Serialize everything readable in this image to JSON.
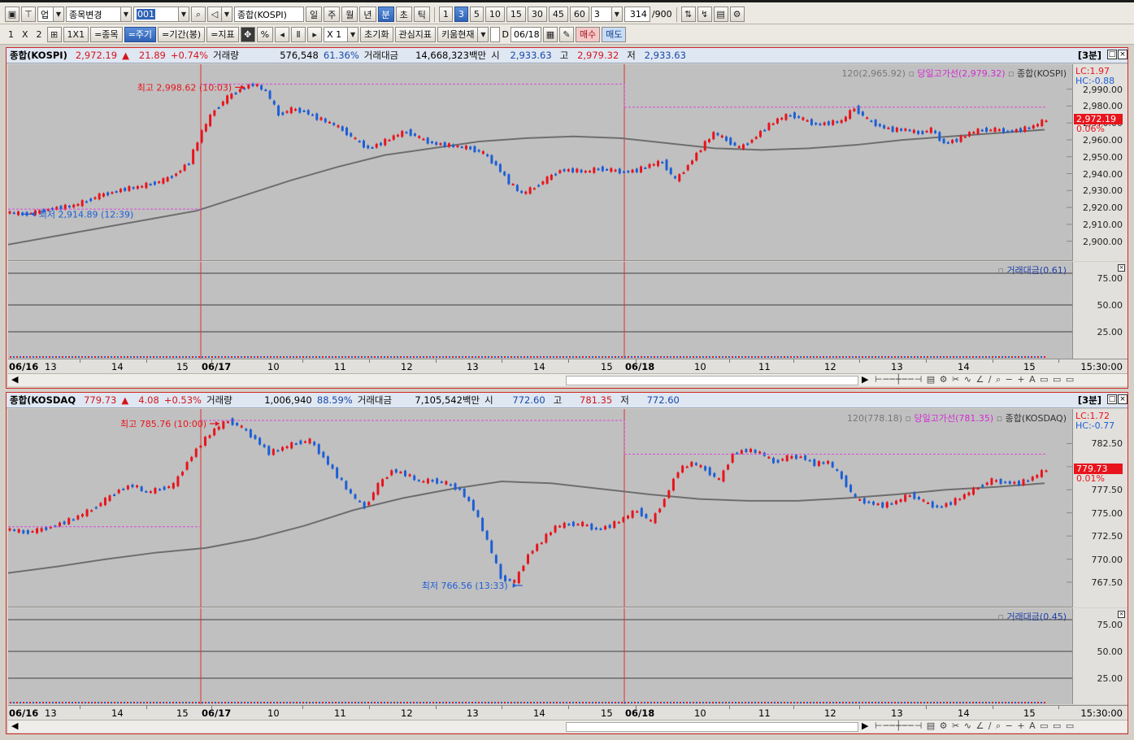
{
  "toolbar1": {
    "tab_label": "업",
    "stock_change": "종목변경",
    "code": "001",
    "stock_name": "종합(KOSPI)",
    "periods": [
      "일",
      "주",
      "월",
      "년",
      "분",
      "초",
      "틱"
    ],
    "minute_values": [
      "1",
      "3",
      "5",
      "10",
      "15",
      "30",
      "45",
      "60"
    ],
    "selected_period": "3",
    "count_display": "314",
    "count_total": "/900"
  },
  "toolbar2": {
    "layout_1": "1",
    "layout_x": "X",
    "layout_2": "2",
    "layout_1x1": "1X1",
    "link_stock": "=종목",
    "link_period": "=주기",
    "link_range": "=기간(봉)",
    "link_indicator": "=지표",
    "percent": "%",
    "mult": "X 1",
    "reset": "초기화",
    "interest": "관심지표",
    "kiwoom": "키움현재",
    "d_label": "D",
    "date": "06/18",
    "buy": "매수",
    "sell": "매도"
  },
  "panels": [
    {
      "name": "종합(KOSPI)",
      "price": "2,972.19",
      "arrow": "▲",
      "change": "21.89",
      "pct": "+0.74%",
      "vol_label": "거래량",
      "volume": "576,548",
      "vol_pct": "61.36%",
      "amt_label": "거래대금",
      "amount": "14,668,323백만",
      "open_label": "시",
      "open": "2,933.63",
      "high_label": "고",
      "high": "2,979.32",
      "low_label": "저",
      "low": "2,933.63",
      "period_tag": "[3분]",
      "ma_label": "120(2,965.92)",
      "day_high_line": "당일고가선(2,979.32)",
      "series_label": "종합(KOSPI)",
      "lc": "LC:1.97",
      "hc": "HC:-0.88",
      "price_tag": "2,972.19",
      "pct_tag": "0.06%",
      "max_label": "최고 2,998.62 (10:03)",
      "min_label": "최저 2,914.89 (12:39)",
      "yticks": [
        "2,990.00",
        "2,980.00",
        "2,970.00",
        "2,960.00",
        "2,950.00",
        "2,940.00",
        "2,930.00",
        "2,920.00",
        "2,910.00",
        "2,900.00"
      ],
      "sub_label": "거래대금(0.61)",
      "sub_ticks": [
        "75.00",
        "50.00",
        "25.00"
      ],
      "xlabels": [
        "06/16",
        "13",
        "14",
        "15",
        "06/17",
        "10",
        "11",
        "12",
        "13",
        "14",
        "15",
        "06/18",
        "10",
        "11",
        "12",
        "13",
        "14",
        "15"
      ],
      "xaxis_time": "15:30:00"
    },
    {
      "name": "종합(KOSDAQ",
      "price": "779.73",
      "arrow": "▲",
      "change": "4.08",
      "pct": "+0.53%",
      "vol_label": "거래량",
      "volume": "1,006,940",
      "vol_pct": "88.59%",
      "amt_label": "거래대금",
      "amount": "7,105,542백만",
      "open_label": "시",
      "open": "772.60",
      "high_label": "고",
      "high": "781.35",
      "low_label": "저",
      "low": "772.60",
      "period_tag": "[3분]",
      "ma_label": "120(778.18)",
      "day_high_line": "당일고가선(781.35)",
      "series_label": "종합(KOSDAQ)",
      "lc": "LC:1.72",
      "hc": "HC:-0.77",
      "price_tag": "779.73",
      "pct_tag": "0.01%",
      "max_label": "최고 785.76 (10:00)",
      "min_label": "최저 766.56 (13:33)",
      "yticks": [
        "782.50",
        "780.00",
        "777.50",
        "775.00",
        "772.50",
        "770.00",
        "767.50"
      ],
      "sub_label": "거래대금(0.45)",
      "sub_ticks": [
        "75.00",
        "50.00",
        "25.00"
      ],
      "xlabels": [
        "06/16",
        "13",
        "14",
        "15",
        "06/17",
        "10",
        "11",
        "12",
        "13",
        "14",
        "15",
        "06/18",
        "10",
        "11",
        "12",
        "13",
        "14",
        "15"
      ],
      "xaxis_time": "15:30:00"
    }
  ],
  "colors": {
    "up": "#e8141c",
    "down": "#1d5fd6",
    "ma": "#6e6e6e",
    "highline": "#d94ad9",
    "divider": "#e03030",
    "accent": "#2f63b8"
  },
  "chart_data": [
    {
      "type": "candlestick",
      "title": "종합(KOSPI)",
      "x": [
        "06/16",
        "06/17",
        "06/18"
      ],
      "y_range": [
        2895,
        2998
      ],
      "close_path": [
        2917,
        2916,
        2917,
        2919,
        2920,
        2921,
        2924,
        2927,
        2929,
        2931,
        2932,
        2934,
        2936,
        2940,
        2947,
        2965,
        2978,
        2985,
        2990,
        2993,
        2989,
        2975,
        2978,
        2977,
        2973,
        2970,
        2966,
        2960,
        2955,
        2958,
        2962,
        2965,
        2961,
        2958,
        2957,
        2956,
        2955,
        2952,
        2945,
        2935,
        2928,
        2932,
        2937,
        2942,
        2942,
        2941,
        2943,
        2942,
        2941,
        2942,
        2945,
        2947,
        2936,
        2945,
        2955,
        2964,
        2960,
        2955,
        2960,
        2967,
        2972,
        2975,
        2972,
        2969,
        2970,
        2971,
        2979,
        2972,
        2968,
        2966,
        2966,
        2964,
        2966,
        2958,
        2960,
        2964,
        2966,
        2966,
        2965,
        2966,
        2968,
        2972
      ],
      "ma_path": [
        2898,
        2903,
        2908,
        2913,
        2918,
        2927,
        2936,
        2944,
        2951,
        2955,
        2959,
        2961,
        2962,
        2961,
        2958,
        2955,
        2954,
        2955,
        2957,
        2960,
        2962,
        2964,
        2966
      ]
    },
    {
      "type": "candlestick",
      "title": "종합(KOSDAQ)",
      "x": [
        "06/16",
        "06/17",
        "06/18"
      ],
      "y_range": [
        766,
        785
      ],
      "close_path": [
        773.2,
        772.9,
        773.1,
        773.5,
        774,
        774.6,
        775.4,
        776.4,
        777.5,
        778,
        777.2,
        777.6,
        778,
        780.5,
        782.5,
        784,
        785,
        784.2,
        783,
        781.5,
        782,
        782.6,
        782.8,
        781,
        779,
        777,
        775.6,
        778,
        779.6,
        779.2,
        778.4,
        778.5,
        778.2,
        777.5,
        775.5,
        772,
        768,
        767.5,
        770.5,
        772,
        773.5,
        773.8,
        773.8,
        773.2,
        773.6,
        774.4,
        775.3,
        774,
        776.5,
        779.6,
        780.4,
        779.7,
        778.5,
        781.4,
        781.8,
        781.5,
        780.5,
        781,
        781.1,
        780.3,
        780.5,
        778.8,
        776.5,
        776.1,
        775.8,
        776.2,
        777,
        776.2,
        775.6,
        776.1,
        776.9,
        777.8,
        778.5,
        778.3,
        778.2,
        778.8,
        779.7
      ],
      "ma_path": [
        768.5,
        769.2,
        770,
        770.7,
        771.2,
        772.2,
        773.6,
        775.3,
        776.6,
        777.6,
        778.4,
        778.2,
        777.6,
        777,
        776.5,
        776.3,
        776.3,
        776.6,
        777,
        777.5,
        777.8,
        778.2
      ]
    }
  ]
}
